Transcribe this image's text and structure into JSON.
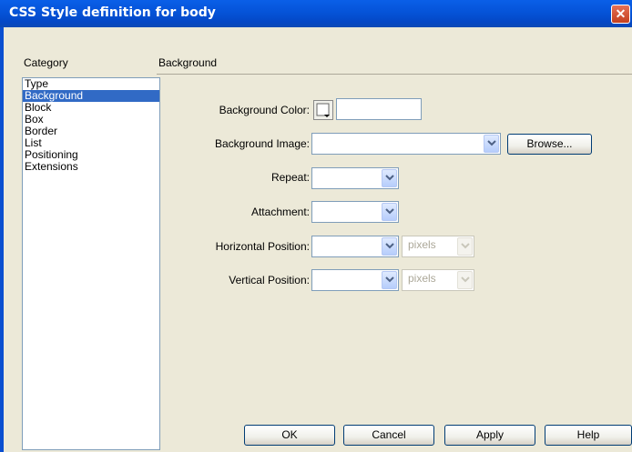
{
  "window": {
    "title": "CSS Style definition for body",
    "close_glyph": "✕"
  },
  "category": {
    "label": "Category",
    "items": [
      "Type",
      "Background",
      "Block",
      "Box",
      "Border",
      "List",
      "Positioning",
      "Extensions"
    ],
    "selected": "Background"
  },
  "panel": {
    "heading": "Background",
    "fields": {
      "background_color": {
        "label": "Background Color:",
        "value": ""
      },
      "background_image": {
        "label": "Background Image:",
        "value": ""
      },
      "repeat": {
        "label": "Repeat:",
        "value": ""
      },
      "attachment": {
        "label": "Attachment:",
        "value": ""
      },
      "horizontal_position": {
        "label": "Horizontal Position:",
        "value": "",
        "unit": "pixels"
      },
      "vertical_position": {
        "label": "Vertical Position:",
        "value": "",
        "unit": "pixels"
      }
    },
    "browse_label": "Browse..."
  },
  "buttons": {
    "ok": "OK",
    "cancel": "Cancel",
    "apply": "Apply",
    "help": "Help"
  },
  "colors": {
    "titlebar": "#0553d8",
    "selection": "#316ac5",
    "dialog_bg": "#ece9d8",
    "close": "#c4401f"
  }
}
